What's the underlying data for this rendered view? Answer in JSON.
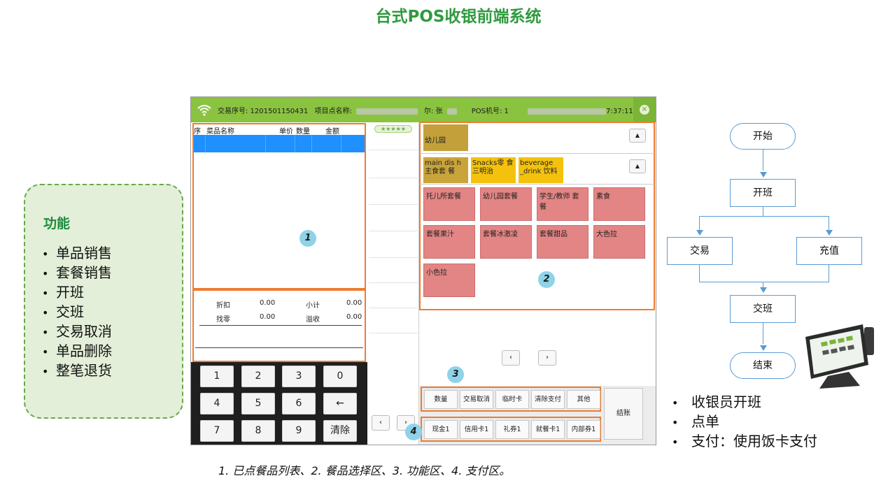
{
  "title": "台式POS收银前端系统",
  "features": {
    "heading": "功能",
    "items": [
      "单品销售",
      "套餐销售",
      "开班",
      "交班",
      "交易取消",
      "单品删除",
      "整笔退货"
    ]
  },
  "pos": {
    "header": {
      "trans_no": "交易序号: 1201501150431",
      "store_label": "项目点名称:",
      "cashier_suffix": "尔: 张",
      "pos_no": "POS机号: 1",
      "time_suffix": "7:37:11"
    },
    "order_columns": [
      "序",
      "菜品名称",
      "单价",
      "数量",
      "金额"
    ],
    "summary": {
      "discount_label": "折扣",
      "discount_value": "0.00",
      "subtotal_label": "小计",
      "subtotal_value": "0.00",
      "change_label": "找零",
      "change_value": "0.00",
      "overflow_label": "溢收",
      "overflow_value": "0.00"
    },
    "keypad": [
      "1",
      "2",
      "3",
      "0",
      "4",
      "5",
      "6",
      "←",
      "7",
      "8",
      "9",
      "清除"
    ],
    "rating": "★★★★★",
    "top_category": "幼儿园",
    "categories": [
      {
        "label": "main dis h主食套 餐",
        "color": "#c9a43a"
      },
      {
        "label": "Snacks零 食三明治",
        "color": "#f4c20d"
      },
      {
        "label": "beverage _drink 饮料",
        "color": "#f4c20d"
      }
    ],
    "dishes": [
      "托儿所套餐",
      "幼儿园套餐",
      "学生/教师 套餐",
      "素食",
      "套餐果汁",
      "套餐冰激凌",
      "套餐甜品",
      "大色拉",
      "小色拉"
    ],
    "up_icon": "▲",
    "prev_icon": "‹",
    "next_icon": "›",
    "functions": [
      "数量",
      "交易取消",
      "临时卡",
      "清除支付",
      "其他"
    ],
    "payments": [
      "现金1",
      "信用卡1",
      "礼券1",
      "就餐卡1",
      "内部券1"
    ],
    "checkout": "结账",
    "close_icon": "×",
    "colors": {
      "header": "#8ac340",
      "highlight_row": "#1e90ff",
      "dish": "#e38585",
      "zone_border": "#ed7d31"
    }
  },
  "badges": [
    "1",
    "2",
    "3",
    "4"
  ],
  "caption": "1. 已点餐品列表、2. 餐品选择区、3. 功能区、4. 支付区。",
  "flow": {
    "start": "开始",
    "open_shift": "开班",
    "trade": "交易",
    "recharge": "充值",
    "close_shift": "交班",
    "end": "结束"
  },
  "notes": [
    "收银员开班",
    "点单",
    "支付：使用饭卡支付"
  ]
}
